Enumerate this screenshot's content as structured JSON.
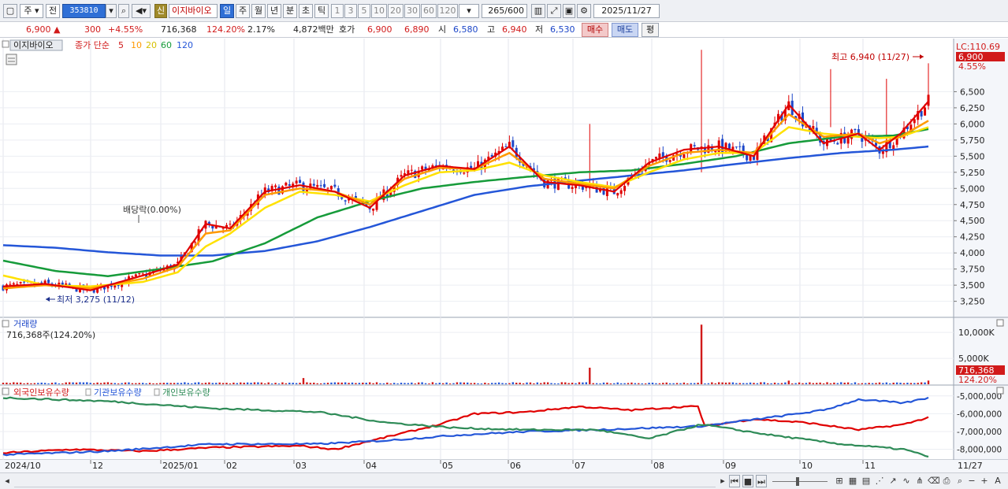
{
  "toolbar": {
    "market": "주",
    "prev_label": "전",
    "code": "353810",
    "sin_label": "신",
    "stock_name": "이지바이오",
    "periods": [
      "일",
      "주",
      "월",
      "년",
      "분",
      "초",
      "틱"
    ],
    "intervals": [
      "1",
      "3",
      "5",
      "10",
      "20",
      "30",
      "60",
      "120"
    ],
    "count": "265",
    "count_total": "/600",
    "date": "2025/11/27"
  },
  "info": {
    "price": "6,900",
    "change": "300",
    "change_pct": "+4.55%",
    "volume": "716,368",
    "volume_ratio": "124.20%",
    "turnover_pct": "2.17%",
    "amount": "4,872백만",
    "quote_label": "호가",
    "ask": "6,900",
    "bid": "6,890",
    "open_label": "시",
    "open": "6,580",
    "high_label": "고",
    "high": "6,940",
    "low_label": "저",
    "low": "6,530",
    "buy_label": "매수",
    "sell_label": "매도",
    "eval_label": "평"
  },
  "price_panel": {
    "name_tag": "이지바이오",
    "legend_prefix": "종가 단순",
    "ma_labels": [
      "5",
      "10",
      "20",
      "60",
      "120"
    ],
    "ma_colors": [
      "#e00000",
      "#ff9900",
      "#ffe100",
      "#169b3a",
      "#2456d8"
    ],
    "lc_label": "LC:110.69",
    "current_price_tag": "6,900",
    "current_pct_tag": "4.55%",
    "high_annotation": "최고 6,940 (11/27)",
    "low_annotation": "최저 3,275 (11/12)",
    "dividend_annotation": "배당락(0.00%)"
  },
  "volume_panel": {
    "title": "거래량",
    "value_label": "716,368주(124.20%)",
    "tag_value": "716,368",
    "tag_pct": "124.20%"
  },
  "holding_panel": {
    "foreign_label": "외국인보유수량",
    "inst_label": "기관보유수량",
    "indiv_label": "개인보유수량",
    "colors": {
      "foreign": "#e00000",
      "inst": "#2456d8",
      "indiv": "#2e8b57"
    }
  },
  "chart_data": [
    {
      "type": "line",
      "title": "이지바이오",
      "x_ticks": [
        "2024/10",
        "12",
        "2025/01",
        "02",
        "03",
        "04",
        "05",
        "06",
        "07",
        "08",
        "09",
        "10",
        "11",
        "11/27"
      ],
      "y_ticks": [
        3250,
        3500,
        3750,
        4000,
        4250,
        4500,
        4750,
        5000,
        5250,
        5500,
        5750,
        6000,
        6250,
        6500
      ],
      "y_tick_labels": [
        "3,250",
        "3,500",
        "3,750",
        "4,000",
        "4,250",
        "4,500",
        "4,750",
        "5,000",
        "5,250",
        "5,500",
        "5,750",
        "6,000",
        "6,250",
        "6,500"
      ],
      "ylim": [
        3050,
        7250
      ],
      "series": [
        {
          "name": "5",
          "x": [
            0,
            12,
            25,
            40,
            50,
            58,
            65,
            75,
            85,
            95,
            105,
            115,
            125,
            135,
            145,
            155,
            165,
            175,
            185,
            195,
            205,
            215,
            225,
            235,
            245,
            251,
            257,
            265
          ],
          "values": [
            3480,
            3520,
            3420,
            3650,
            3820,
            4450,
            4380,
            4950,
            5050,
            4950,
            4700,
            5200,
            5350,
            5300,
            5650,
            5100,
            5050,
            4950,
            5400,
            5600,
            5650,
            5500,
            6300,
            5700,
            5850,
            5600,
            5850,
            6350
          ]
        },
        {
          "name": "10",
          "x": [
            0,
            12,
            25,
            40,
            50,
            58,
            65,
            75,
            85,
            95,
            105,
            115,
            125,
            135,
            145,
            155,
            165,
            175,
            185,
            195,
            205,
            215,
            225,
            235,
            245,
            251,
            257,
            265
          ],
          "values": [
            3450,
            3500,
            3450,
            3600,
            3780,
            4300,
            4350,
            4900,
            5000,
            4950,
            4750,
            5150,
            5320,
            5300,
            5550,
            5150,
            5070,
            5000,
            5350,
            5550,
            5600,
            5550,
            6150,
            5800,
            5850,
            5700,
            5800,
            6050
          ]
        },
        {
          "name": "20",
          "x": [
            0,
            12,
            25,
            40,
            50,
            58,
            65,
            75,
            85,
            95,
            105,
            115,
            125,
            135,
            145,
            155,
            165,
            175,
            185,
            195,
            205,
            215,
            225,
            235,
            245,
            251,
            257,
            265
          ],
          "values": [
            3650,
            3500,
            3480,
            3550,
            3700,
            4100,
            4300,
            4700,
            4950,
            4900,
            4800,
            5050,
            5250,
            5280,
            5400,
            5200,
            5100,
            5020,
            5250,
            5450,
            5550,
            5550,
            5950,
            5850,
            5800,
            5780,
            5800,
            5950
          ]
        },
        {
          "name": "60",
          "x": [
            0,
            15,
            30,
            45,
            60,
            75,
            90,
            105,
            120,
            135,
            150,
            165,
            180,
            195,
            210,
            225,
            240,
            255,
            265
          ],
          "values": [
            3880,
            3720,
            3640,
            3750,
            3870,
            4150,
            4550,
            4800,
            5000,
            5100,
            5180,
            5250,
            5280,
            5380,
            5500,
            5700,
            5800,
            5820,
            5920
          ]
        },
        {
          "name": "120",
          "x": [
            0,
            15,
            30,
            45,
            60,
            75,
            90,
            105,
            120,
            135,
            150,
            165,
            180,
            195,
            210,
            225,
            240,
            255,
            265
          ],
          "values": [
            4120,
            4080,
            4010,
            3960,
            3960,
            4030,
            4180,
            4400,
            4650,
            4900,
            5030,
            5120,
            5200,
            5280,
            5380,
            5470,
            5550,
            5600,
            5650
          ]
        }
      ]
    },
    {
      "type": "bar",
      "title": "거래량",
      "y_ticks": [
        5000,
        10000
      ],
      "y_tick_labels": [
        "5,000K",
        "10,000K"
      ],
      "ylim": [
        0,
        12000
      ],
      "spikes": [
        {
          "x": 86,
          "value": 1200
        },
        {
          "x": 168,
          "value": 3200
        },
        {
          "x": 200,
          "value": 11500
        },
        {
          "x": 225,
          "value": 700
        },
        {
          "x": 265,
          "value": 716
        }
      ]
    },
    {
      "type": "line",
      "title": "보유수량",
      "y_ticks": [
        -5000000,
        -6000000,
        -7000000,
        -8000000
      ],
      "y_tick_labels": [
        "-5,000,000",
        "-6,000,000",
        "-7,000,000",
        "-8,000,000"
      ],
      "ylim": [
        -8500000,
        -4700000
      ],
      "series": [
        {
          "name": "외국인보유수량",
          "x": [
            0,
            20,
            40,
            60,
            85,
            95,
            110,
            125,
            135,
            150,
            165,
            180,
            195,
            199,
            201,
            215,
            230,
            245,
            258,
            265
          ],
          "values": [
            -8200000,
            -8000000,
            -8100000,
            -7900000,
            -7800000,
            -8000000,
            -7300000,
            -6600000,
            -6000000,
            -5900000,
            -5600000,
            -5800000,
            -5600000,
            -5600000,
            -6700000,
            -6300000,
            -6500000,
            -6900000,
            -6600000,
            -6200000
          ]
        },
        {
          "name": "기관보유수량",
          "x": [
            0,
            30,
            60,
            90,
            110,
            130,
            150,
            170,
            200,
            220,
            235,
            245,
            258,
            265
          ],
          "values": [
            -8300000,
            -8100000,
            -7700000,
            -7700000,
            -7500000,
            -7200000,
            -7000000,
            -6900000,
            -6700000,
            -6200000,
            -5800000,
            -5200000,
            -5400000,
            -5100000
          ]
        },
        {
          "name": "개인보유수량",
          "x": [
            0,
            30,
            60,
            90,
            110,
            130,
            150,
            170,
            185,
            200,
            220,
            240,
            258,
            265
          ],
          "values": [
            -5100000,
            -5300000,
            -5700000,
            -5900000,
            -6500000,
            -6800000,
            -6900000,
            -6900000,
            -7400000,
            -6600000,
            -7200000,
            -7700000,
            -8000000,
            -8400000
          ]
        }
      ]
    }
  ]
}
